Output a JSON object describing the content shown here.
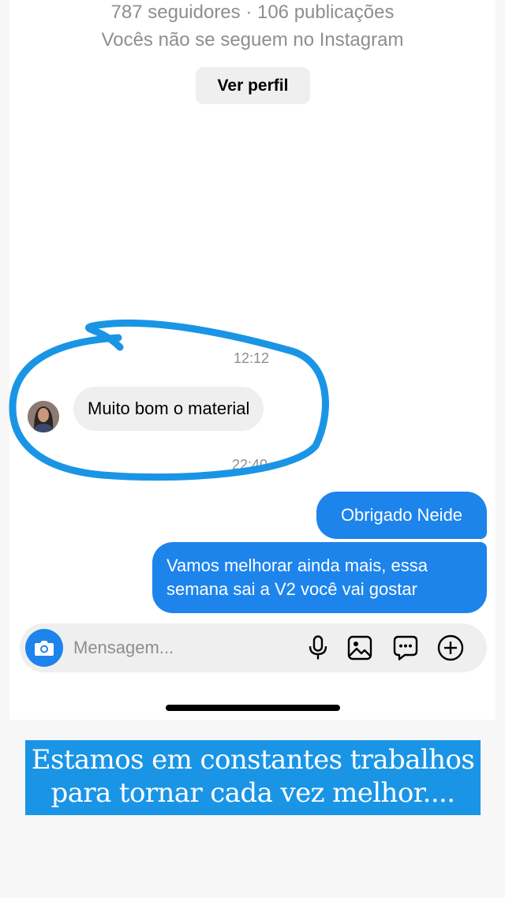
{
  "profile": {
    "stats": "787 seguidores · 106 publicações",
    "follow_status": "Vocês não se seguem no Instagram",
    "view_profile_label": "Ver perfil"
  },
  "conversation": {
    "timestamp_1": "12:12",
    "received_message": "Muito bom o material",
    "timestamp_2": "22:40",
    "sent_messages": [
      "Obrigado Neide",
      "Vamos melhorar ainda mais, essa semana sai a V2 você vai gostar"
    ]
  },
  "composer": {
    "placeholder": "Mensagem...",
    "icons": [
      "camera-icon",
      "microphone-icon",
      "gallery-icon",
      "sticker-icon",
      "plus-icon"
    ]
  },
  "caption": {
    "line_1": "Estamos em constantes trabalhos",
    "line_2": "para tornar cada vez melhor...."
  },
  "colors": {
    "accent_blue": "#1d84ec",
    "annotation_blue": "#1a95e6",
    "received_bubble": "#efefef",
    "muted_text": "#8e8e8e"
  }
}
